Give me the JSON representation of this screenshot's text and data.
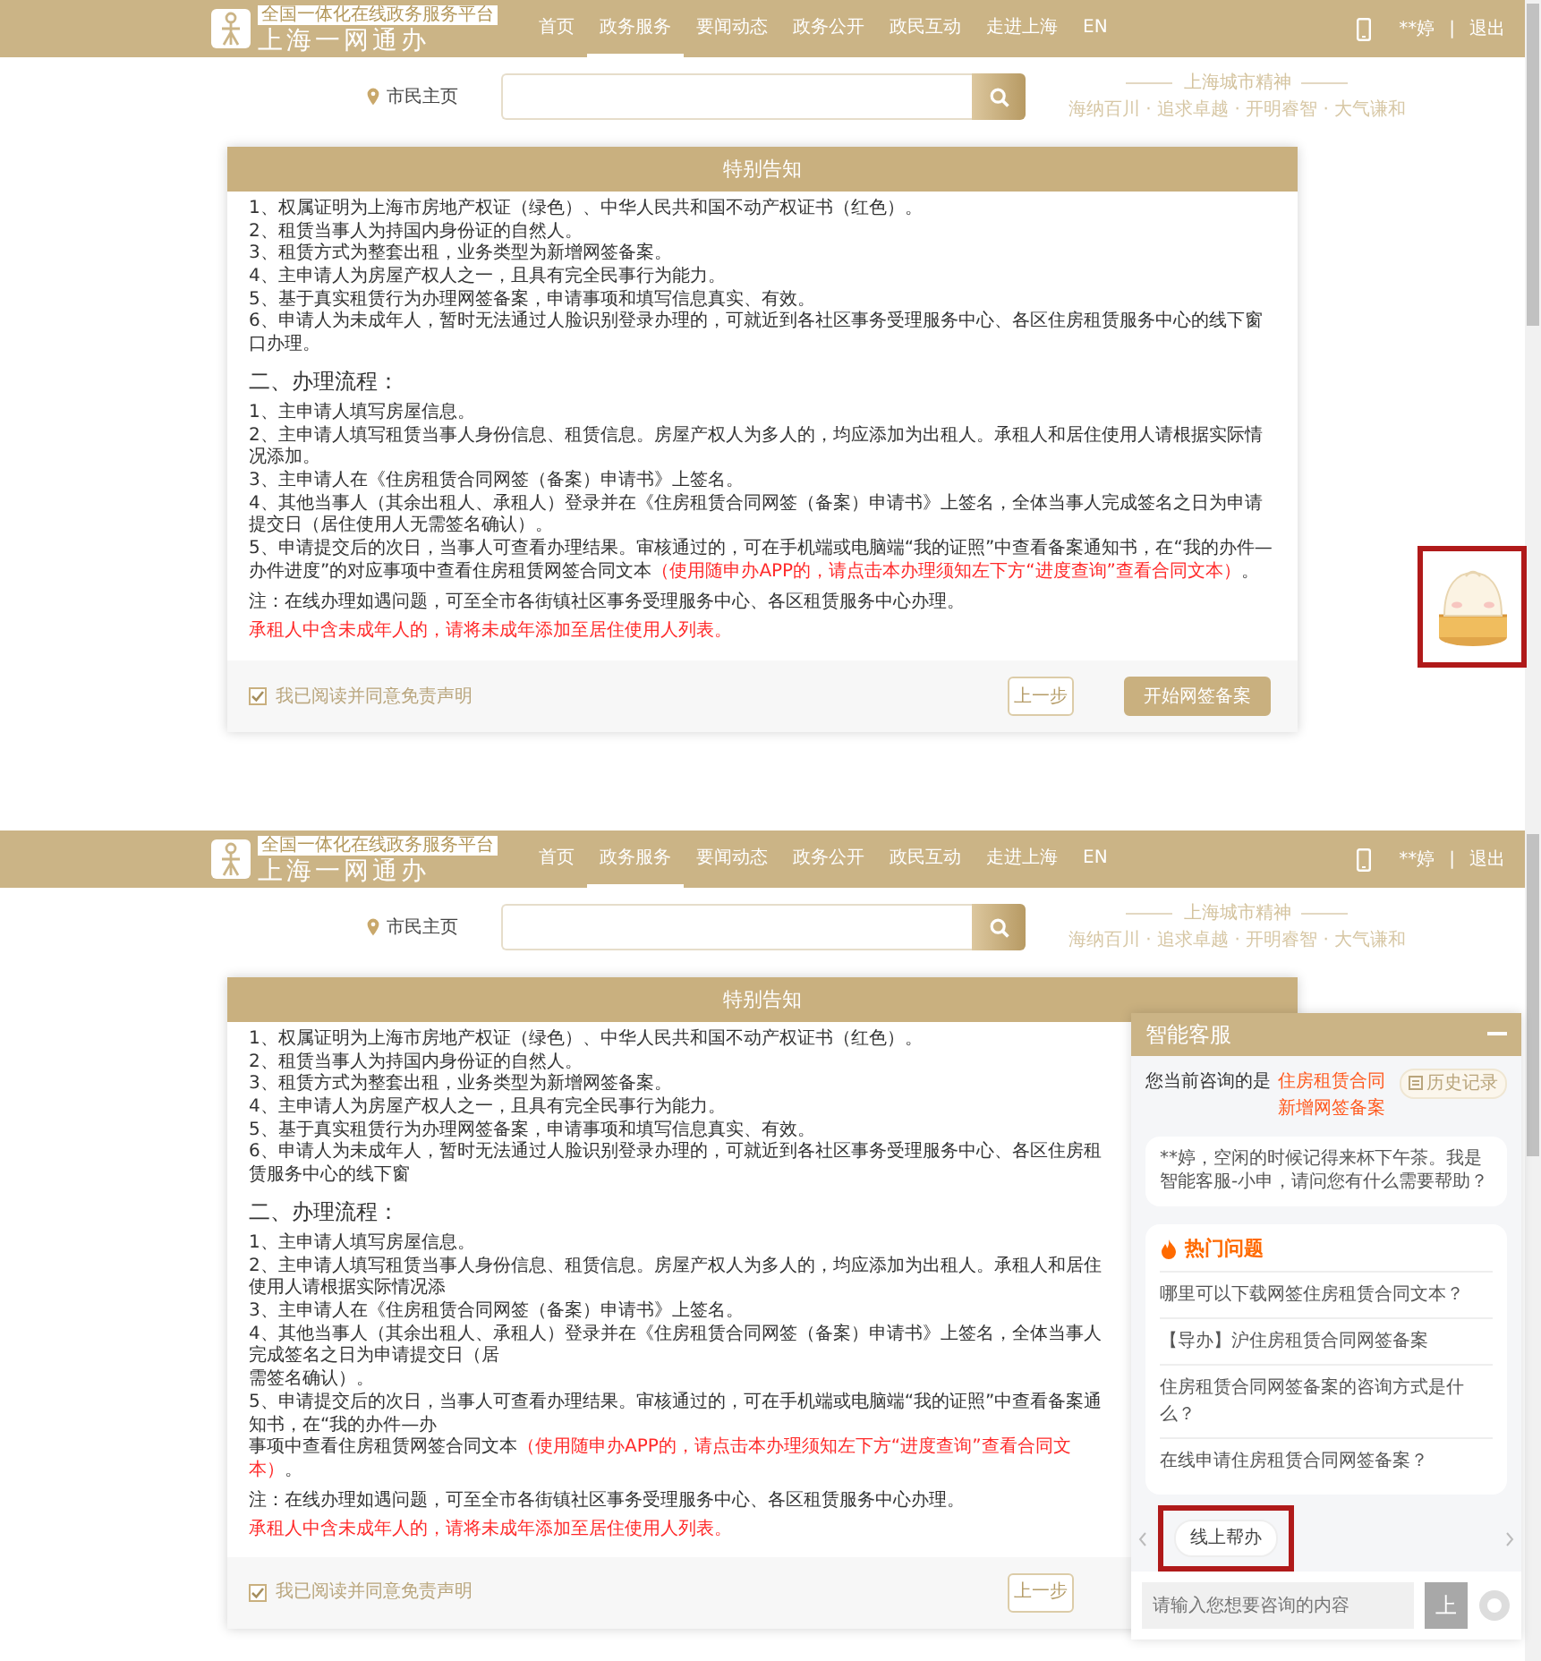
{
  "screens": [
    {
      "header": {
        "platform_label": "全国一体化在线政务服务平台",
        "site_name": "上海一网通办",
        "nav": [
          {
            "label": "首页",
            "selected": false
          },
          {
            "label": "政务服务",
            "selected": true
          },
          {
            "label": "要闻动态",
            "selected": false
          },
          {
            "label": "政务公开",
            "selected": false
          },
          {
            "label": "政民互动",
            "selected": false
          },
          {
            "label": "走进上海",
            "selected": false
          },
          {
            "label": "EN",
            "selected": false
          }
        ],
        "user": "**婷",
        "separator": "|",
        "logout": "退出"
      },
      "search": {
        "home_link": "市民主页"
      },
      "spirit": {
        "title": "上海城市精神",
        "motto": "海纳百川 · 追求卓越 · 开明睿智 · 大气谦和"
      },
      "notice": {
        "title": "特别告知",
        "requirements": [
          "1、权属证明为上海市房地产权证（绿色）、中华人民共和国不动产权证书（红色）。",
          "2、租赁当事人为持国内身份证的自然人。",
          "3、租赁方式为整套出租，业务类型为新增网签备案。",
          "4、主申请人为房屋产权人之一，且具有完全民事行为能力。",
          "5、基于真实租赁行为办理网签备案，申请事项和填写信息真实、有效。",
          "6、申请人为未成年人，暂时无法通过人脸识别登录办理的，可就近到各社区事务受理服务中心、各区住房租赁服务中心的线下窗口办理。"
        ],
        "process_heading": "二、办理流程：",
        "process": [
          {
            "text": "1、主申请人填写房屋信息。"
          },
          {
            "text": "2、主申请人填写租赁当事人身份信息、租赁信息。房屋产权人为多人的，均应添加为出租人。承租人和居住使用人请根据实际情况添加。"
          },
          {
            "text": "3、主申请人在《住房租赁合同网签（备案）申请书》上签名。"
          },
          {
            "text": "4、其他当事人（其余出租人、承租人）登录并在《住房租赁合同网签（备案）申请书》上签名，全体当事人完成签名之日为申请提交日（居住使用人无需签名确认）。"
          },
          {
            "text": "5、申请提交后的次日，当事人可查看办理结果。审核通过的，可在手机端或电脑端“我的证照”中查看备案通知书，在“我的办件—办件进度”的对应事项中查看住房租赁网签合同文本",
            "note": "（使用随申办APP的，请点击本办理须知左下方“进度查询”查看合同文本）",
            "end": "。"
          }
        ],
        "note": "注：在线办理如遇问题，可至全市各街镇社区事务受理服务中心、各区租赁服务中心办理。",
        "warning": "承租人中含未成年人的，请将未成年添加至居住使用人列表。",
        "agreement": {
          "label": "我已阅读并同意免责声明",
          "checked": true
        },
        "buttons": [
          {
            "label": "上一步",
            "kind": "outline"
          },
          {
            "label": "开始网签备案",
            "kind": "primary"
          }
        ]
      },
      "mascot": {
        "highlighted": true
      }
    },
    {
      "header": {
        "platform_label": "全国一体化在线政务服务平台",
        "site_name": "上海一网通办",
        "nav": [
          {
            "label": "首页",
            "selected": false
          },
          {
            "label": "政务服务",
            "selected": true
          },
          {
            "label": "要闻动态",
            "selected": false
          },
          {
            "label": "政务公开",
            "selected": false
          },
          {
            "label": "政民互动",
            "selected": false
          },
          {
            "label": "走进上海",
            "selected": false
          },
          {
            "label": "EN",
            "selected": false
          }
        ],
        "user": "**婷",
        "separator": "|",
        "logout": "退出"
      },
      "search": {
        "home_link": "市民主页"
      },
      "spirit": {
        "title": "上海城市精神",
        "motto": "海纳百川 · 追求卓越 · 开明睿智 · 大气谦和"
      },
      "notice": {
        "title": "特别告知",
        "requirements": [
          "1、权属证明为上海市房地产权证（绿色）、中华人民共和国不动产权证书（红色）。",
          "2、租赁当事人为持国内身份证的自然人。",
          "3、租赁方式为整套出租，业务类型为新增网签备案。",
          "4、主申请人为房屋产权人之一，且具有完全民事行为能力。",
          "5、基于真实租赁行为办理网签备案，申请事项和填写信息真实、有效。",
          "6、申请人为未成年人，暂时无法通过人脸识别登录办理的，可就近到各社区事务受理服务中心、各区住房租赁服务中心的线下窗"
        ],
        "process_heading": "二、办理流程：",
        "process": [
          {
            "text": "1、主申请人填写房屋信息。"
          },
          {
            "text": "2、主申请人填写租赁当事人身份信息、租赁信息。房屋产权人为多人的，均应添加为出租人。承租人和居住使用人请根据实际情况添"
          },
          {
            "text": "3、主申请人在《住房租赁合同网签（备案）申请书》上签名。"
          },
          {
            "text": "4、其他当事人（其余出租人、承租人）登录并在《住房租赁合同网签（备案）申请书》上签名，全体当事人完成签名之日为申请提交日（居"
          },
          {
            "text": "需签名确认）。"
          },
          {
            "text": "5、申请提交后的次日，当事人可查看办理结果。审核通过的，可在手机端或电脑端“我的证照”中查看备案通知书，在“我的办件—办"
          },
          {
            "text": "事项中查看住房租赁网签合同文本",
            "note": "（使用随申办APP的，请点击本办理须知左下方“进度查询”查看合同文本）",
            "end": "。"
          }
        ],
        "note": "注：在线办理如遇问题，可至全市各街镇社区事务受理服务中心、各区租赁服务中心办理。",
        "warning": "承租人中含未成年人的，请将未成年添加至居住使用人列表。",
        "agreement": {
          "label": "我已阅读并同意免责声明",
          "checked": true
        },
        "buttons": [
          {
            "label": "上一步",
            "kind": "outline"
          }
        ]
      },
      "chat": {
        "title": "智能客服",
        "topic_label": "您当前咨询的是",
        "topic": "住房租赁合同新增网签备案",
        "history": "历史记录",
        "greeting": "**婷，空闲的时候记得来杯下午茶。我是智能客服-小申，请问您有什么需要帮助？",
        "hot_title": "热门问题",
        "questions": [
          "哪里可以下载网签住房租赁合同文本？",
          "【导办】沪住房租赁合同网签备案",
          "住房租赁合同网签备案的咨询方式是什么？",
          "在线申请住房租赁合同网签备案？"
        ],
        "chips": [
          {
            "label": "线上帮办",
            "highlighted": true
          }
        ],
        "input_placeholder": "请输入您想要咨询的内容",
        "send": "上"
      }
    }
  ]
}
